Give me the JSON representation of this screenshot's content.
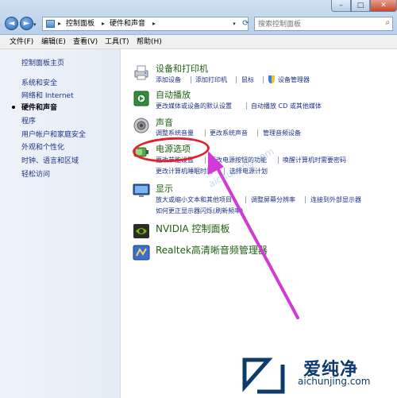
{
  "breadcrumb": {
    "root_label": "控制面板",
    "current_label": "硬件和声音",
    "separator": "▸"
  },
  "search": {
    "placeholder": "搜索控制面板"
  },
  "nav": {
    "back_glyph": "◄",
    "forward_glyph": "►",
    "dropdown_glyph": "▾",
    "refresh_glyph": "⟳"
  },
  "window_controls": {
    "minimize": "–",
    "maximize": "□",
    "close": "✕"
  },
  "menubar": {
    "file": "文件(F)",
    "edit": "编辑(E)",
    "view": "查看(V)",
    "tools": "工具(T)",
    "help": "帮助(H)"
  },
  "sidebar": {
    "items": [
      {
        "label": "控制面板主页"
      },
      {
        "label": "系统和安全"
      },
      {
        "label": "网络和 Internet"
      },
      {
        "label": "硬件和声音",
        "current": true
      },
      {
        "label": "程序"
      },
      {
        "label": "用户帐户和家庭安全"
      },
      {
        "label": "外观和个性化"
      },
      {
        "label": "时钟、语言和区域"
      },
      {
        "label": "轻松访问"
      }
    ]
  },
  "categories": {
    "devices": {
      "title": "设备和打印机",
      "icon": "printer-icon",
      "tasks": [
        "添加设备",
        "添加打印机",
        "鼠标",
        "设备管理器"
      ]
    },
    "autoplay": {
      "title": "自动播放",
      "icon": "autoplay-icon",
      "tasks": [
        "更改媒体或设备的默认设置",
        "自动播放 CD 或其他媒体"
      ]
    },
    "sound": {
      "title": "声音",
      "icon": "speaker-icon",
      "tasks": [
        "调整系统音量",
        "更改系统声音",
        "管理音频设备"
      ]
    },
    "power": {
      "title": "电源选项",
      "icon": "power-icon",
      "tasks": [
        "更改节能设置",
        "更改电源按钮的功能",
        "唤醒计算机时需要密码",
        "更改计算机睡眠时间",
        "选择电源计划"
      ]
    },
    "display": {
      "title": "显示",
      "icon": "monitor-icon",
      "tasks": [
        "放大或缩小文本和其他项目",
        "调整屏幕分辨率",
        "连接到外部显示器",
        "如何更正显示器闪烁(刷新频率)"
      ]
    },
    "nvidia": {
      "title": "NVIDIA 控制面板",
      "icon": "nvidia-icon"
    },
    "realtek": {
      "title": "Realtek高清晰音频管理器",
      "icon": "realtek-icon"
    }
  },
  "branding": {
    "name": "爱纯净",
    "url": "aichunjing.com",
    "watermark_url": "aichunjing.com"
  },
  "colors": {
    "annotation_red": "#e5202a",
    "arrow_magenta": "#d23ad6",
    "link_blue": "#1e3287",
    "category_green": "#1f5f0f"
  }
}
